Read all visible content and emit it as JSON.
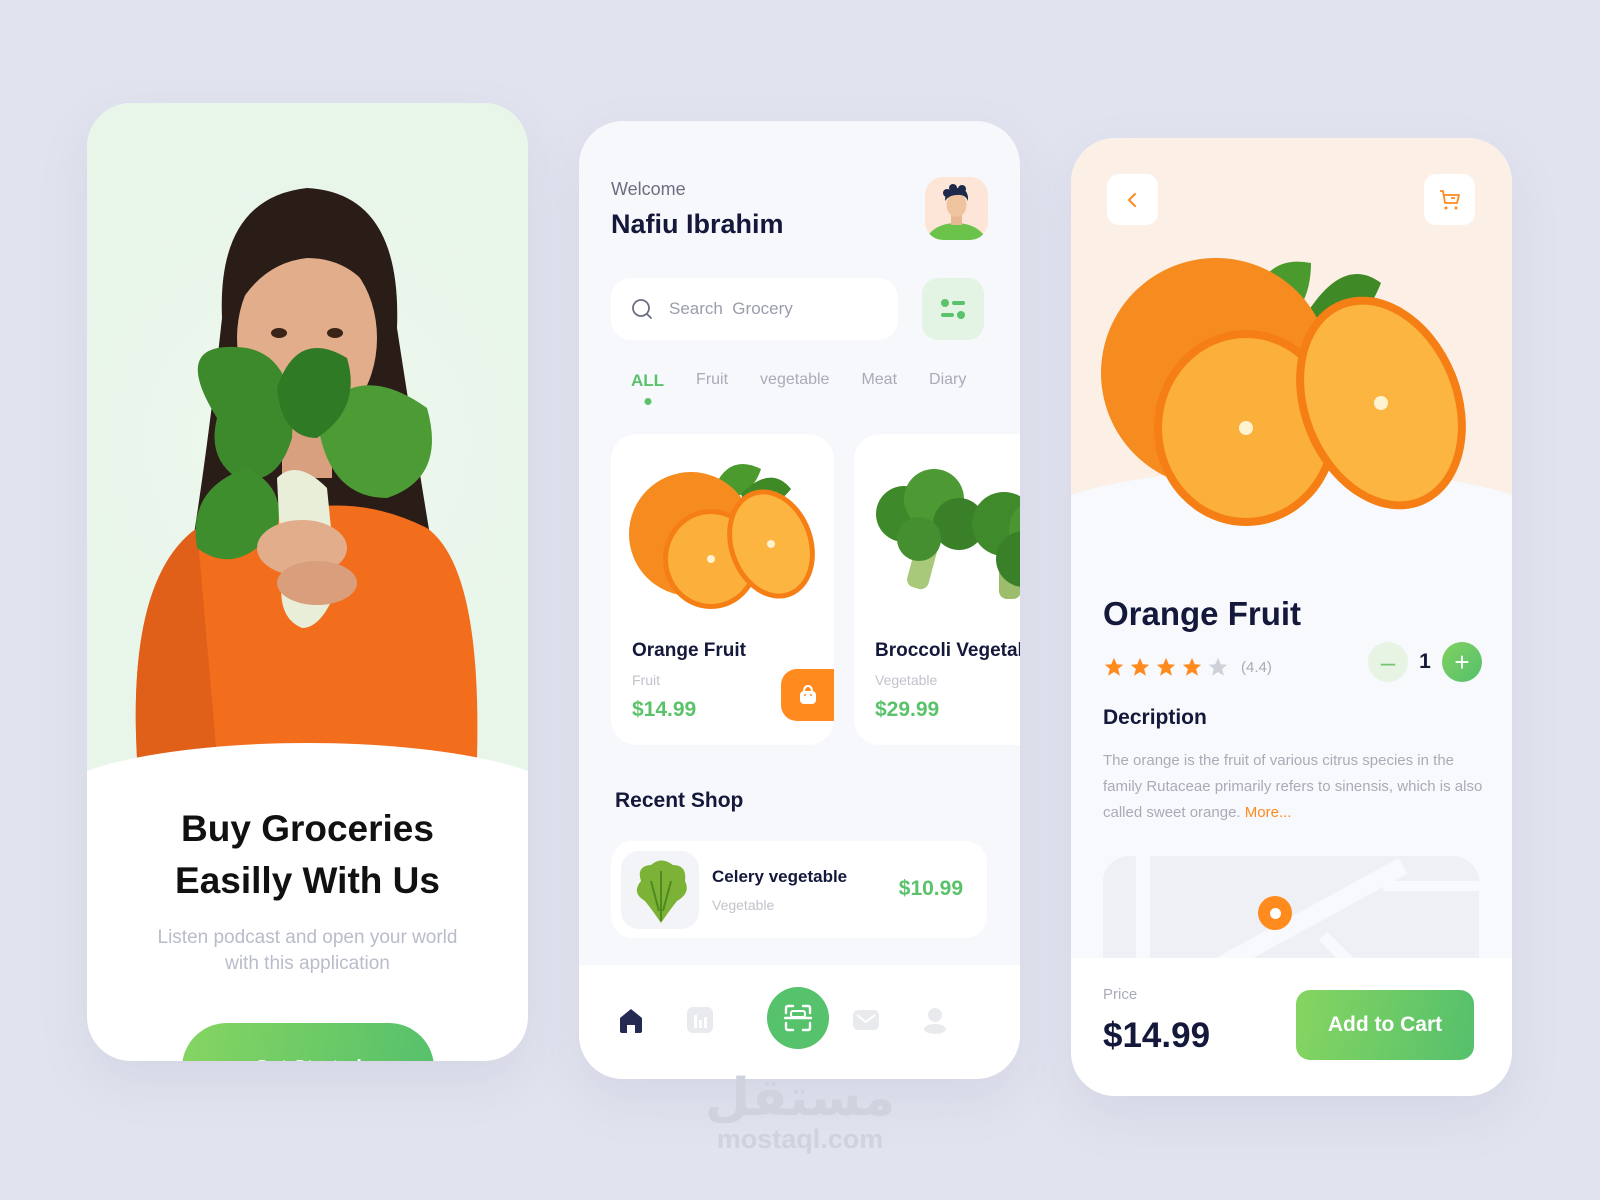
{
  "colors": {
    "background": "#e1e3ef",
    "accent_green": "#5ac26a",
    "accent_orange": "#ff8a1e",
    "text_dark": "#14183a",
    "text_muted": "#a9acb7"
  },
  "onboarding": {
    "title_line1": "Buy Groceries",
    "title_line2": "Easilly With Us",
    "subtitle": "Listen podcast and open your world with this application",
    "cta_label": "Get Started"
  },
  "home": {
    "welcome_label": "Welcome",
    "user_name": "Nafiu Ibrahim",
    "search": {
      "placeholder": "Search  Grocery",
      "value": ""
    },
    "tabs": [
      {
        "label": "ALL",
        "active": true
      },
      {
        "label": "Fruit",
        "active": false
      },
      {
        "label": "vegetable",
        "active": false
      },
      {
        "label": "Meat",
        "active": false
      },
      {
        "label": "Diary",
        "active": false
      }
    ],
    "products": [
      {
        "name": "Orange Fruit",
        "category": "Fruit",
        "price": "$14.99",
        "icon": "orange-image"
      },
      {
        "name": "Broccoli Vegetable",
        "category": "Vegetable",
        "price": "$29.99",
        "icon": "broccoli-image"
      }
    ],
    "recent_section_title": "Recent Shop",
    "recent": [
      {
        "name": "Celery vegetable",
        "category": "Vegetable",
        "price": "$10.99",
        "icon": "celery-image"
      }
    ],
    "bottom_nav": [
      {
        "icon": "home-icon",
        "active": true
      },
      {
        "icon": "chart-icon",
        "active": false
      },
      {
        "icon": "scan-icon",
        "active": false
      },
      {
        "icon": "mail-icon",
        "active": false
      },
      {
        "icon": "profile-icon",
        "active": false
      }
    ]
  },
  "detail": {
    "title": "Orange Fruit",
    "rating": 4.4,
    "rating_text": "(4.4)",
    "stars_filled": 4,
    "stars_total": 5,
    "quantity": "1",
    "description_title": "Decription",
    "description": "The orange is the fruit of various citrus species in the family Rutaceae primarily refers to sinensis, which is also called sweet orange.",
    "more_label": "More...",
    "price_label": "Price",
    "price": "$14.99",
    "add_to_cart_label": "Add to Cart"
  },
  "watermark": {
    "arabic": "مستقل",
    "latin": "mostaql.com"
  }
}
